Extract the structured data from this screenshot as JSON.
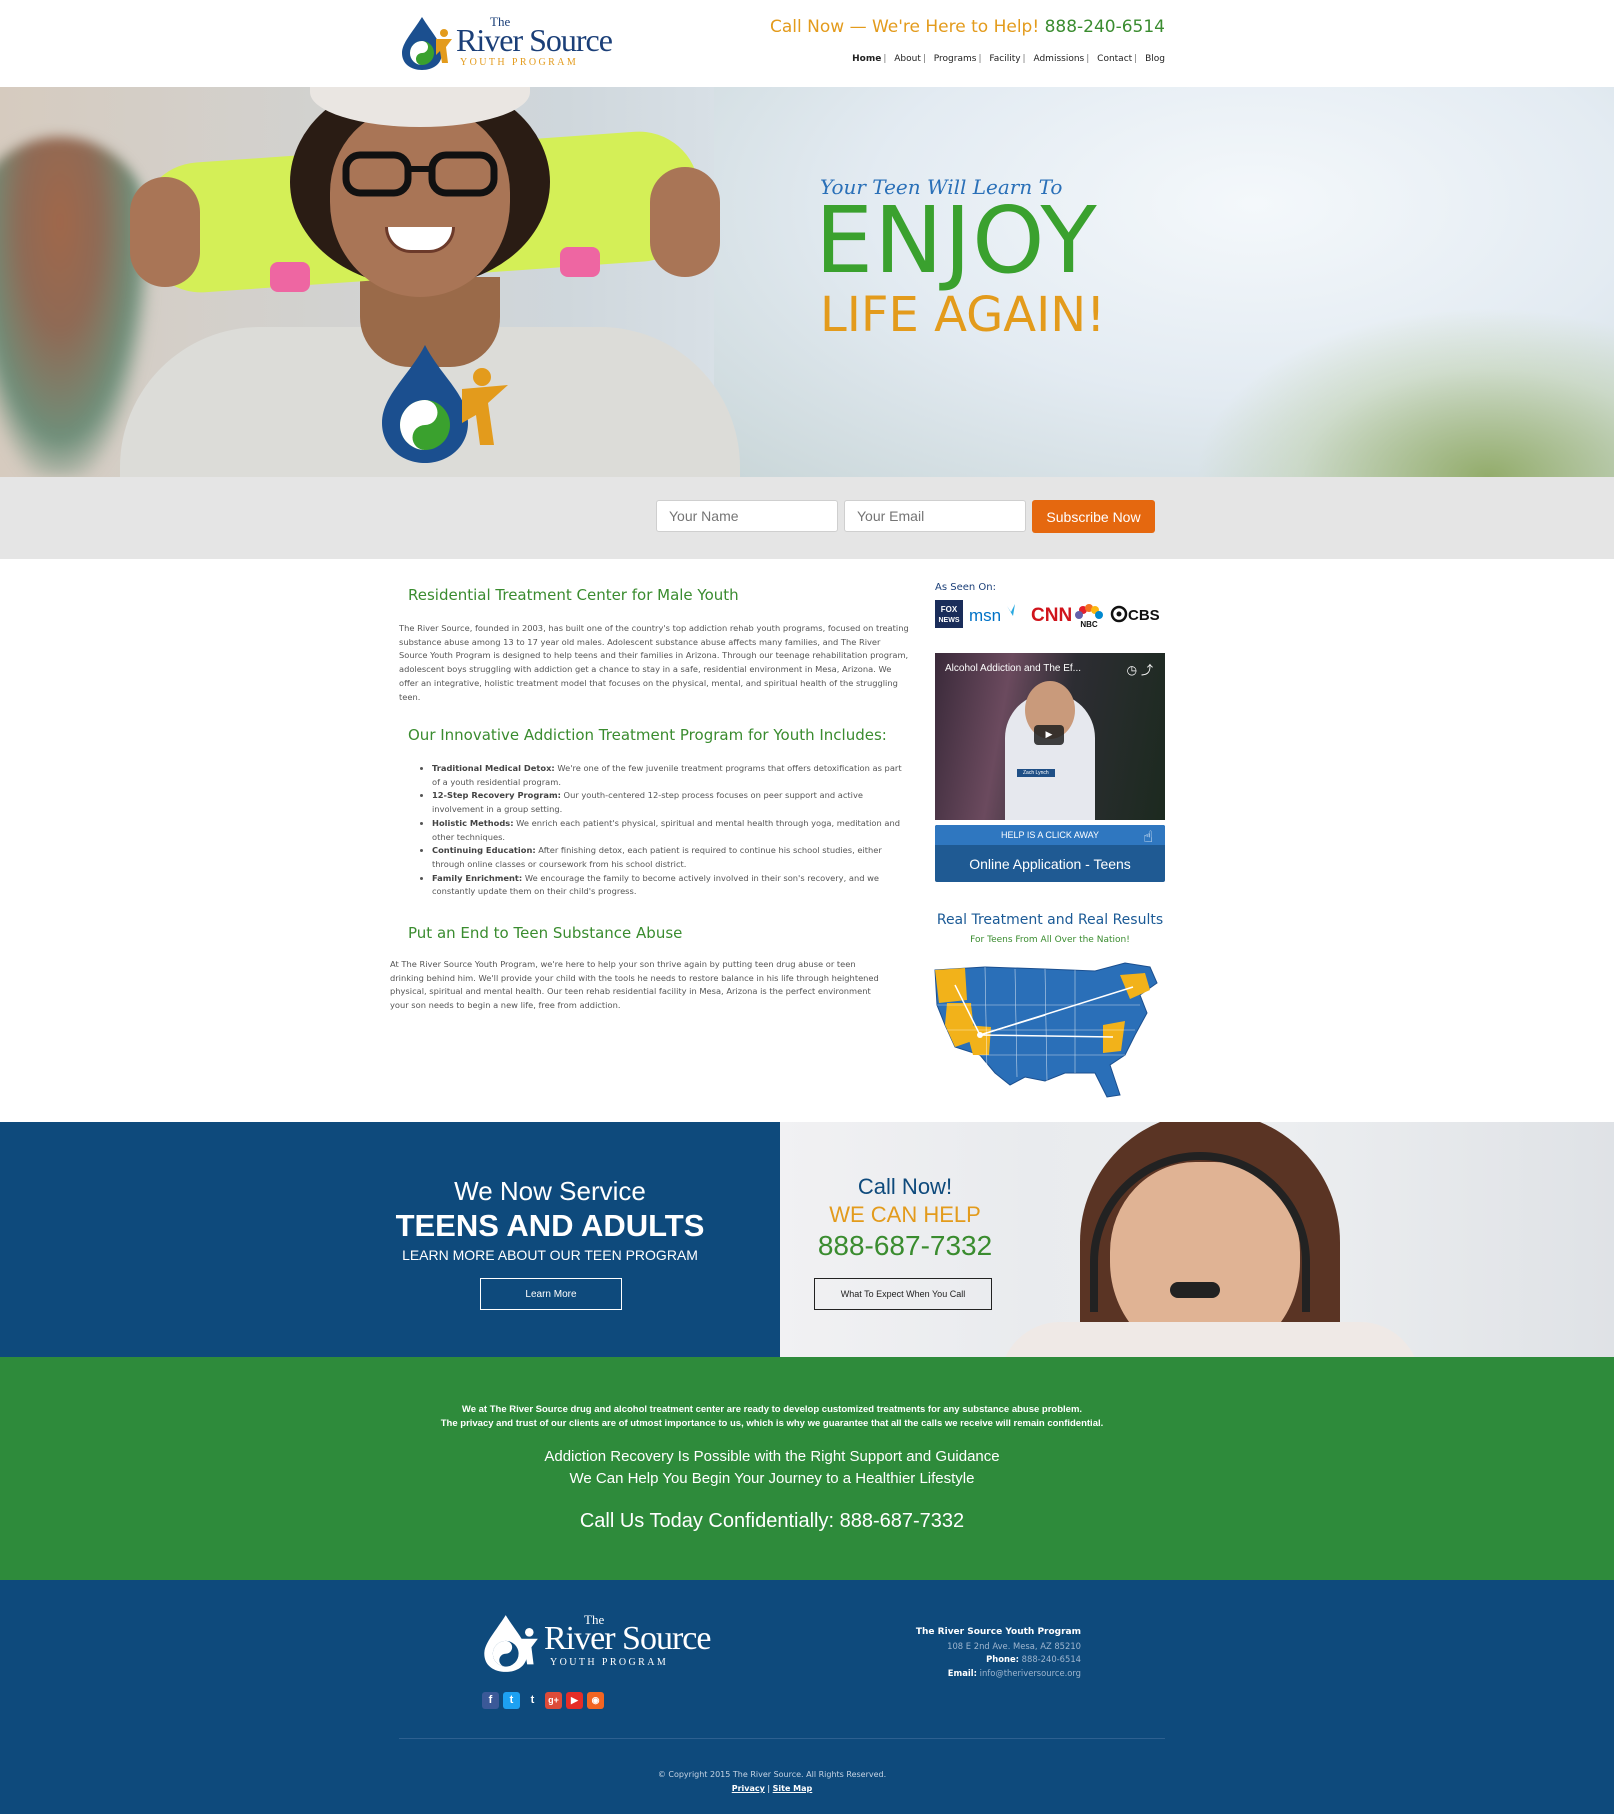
{
  "header": {
    "logo": {
      "the": "The",
      "name": "River Source",
      "sub": "YOUTH PROGRAM"
    },
    "callnow_text": "Call Now — We're Here to Help!",
    "callnow_phone": "888-240-6514",
    "nav": [
      {
        "label": "Home"
      },
      {
        "label": "About"
      },
      {
        "label": "Programs"
      },
      {
        "label": "Facility"
      },
      {
        "label": "Admissions"
      },
      {
        "label": "Contact"
      },
      {
        "label": "Blog"
      }
    ],
    "nav_separator": "|"
  },
  "hero": {
    "subtitle": "Your Teen Will Learn To",
    "headline": "ENJOY",
    "headline2": "LIFE AGAIN!"
  },
  "subscribe": {
    "name_placeholder": "Your Name",
    "email_placeholder": "Your Email",
    "button": "Subscribe Now",
    "button_color": "#e5680f"
  },
  "content": {
    "h1": "Residential Treatment Center for Male Youth",
    "p1": "The River Source, founded in 2003, has built one of the country's top addiction rehab youth programs, focused on treating substance abuse among 13 to 17 year old males. Adolescent substance abuse affects many families, and The River Source Youth Program is designed to help teens and their families in Arizona. Through our teenage rehabilitation program, adolescent boys struggling with addiction get a chance to stay in a safe, residential environment in Mesa, Arizona. We offer an integrative, holistic treatment model that focuses on the physical, mental, and spiritual health of the struggling teen.",
    "h2": "Our Innovative Addiction Treatment Program for Youth Includes:",
    "list": [
      {
        "term": "Traditional Medical Detox:",
        "text": " We're one of the few juvenile treatment programs that offers detoxification as part of a youth residential program."
      },
      {
        "term": "12-Step Recovery Program:",
        "text": " Our youth-centered 12-step process focuses on peer support and active involvement in a group setting."
      },
      {
        "term": "Holistic Methods:",
        "text": " We enrich each patient's physical, spiritual and mental health through yoga, meditation and other techniques."
      },
      {
        "term": "Continuing Education:",
        "text": " After finishing detox, each patient is required to continue his school studies, either through online classes or coursework from his school district."
      },
      {
        "term": "Family Enrichment:",
        "text": " We encourage the family to become actively involved in their son's recovery, and we constantly update them on their child's progress."
      }
    ],
    "h3": "Put an End to Teen Substance Abuse",
    "p3": "At The River Source Youth Program, we're here to help your son thrive again by putting teen drug abuse or teen drinking behind him. We'll provide your child with the tools he needs to restore balance in his life through heightened physical, spiritual and mental health. Our teen rehab residential facility in Mesa, Arizona is the perfect environment your son needs to begin a new life, free from addiction."
  },
  "sidebar": {
    "as_seen_on": "As Seen On:",
    "media": [
      {
        "label": "FOX NEWS"
      },
      {
        "label": "msn"
      },
      {
        "label": "CNN"
      },
      {
        "label": "NBC"
      },
      {
        "label": "CBS"
      }
    ],
    "video_title": "Alcohol Addiction and The Ef...",
    "video_caption": "Zach Lynch",
    "app_top": "HELP IS A CLICK AWAY",
    "app_main": "Online Application - Teens",
    "real_title": "Real Treatment and Real Results",
    "real_sub": "For Teens From All Over the Nation!"
  },
  "services": {
    "now": "We Now Service",
    "teens": "TEENS AND ADULTS",
    "learn": "LEARN MORE ABOUT OUR TEEN PROGRAM",
    "learn_btn": "Learn More",
    "call_now": "Call Now!",
    "we_help": "WE CAN HELP",
    "phone": "888-687-7332",
    "expect_btn": "What To Expect When You Call"
  },
  "green": {
    "small1": "We at The River Source drug and alcohol treatment center are ready to develop customized treatments for any substance abuse problem.",
    "small2": "The privacy and trust of our clients are of utmost importance to us, which is why we guarantee that all the calls we receive will remain confidential.",
    "mid1": "Addiction Recovery Is Possible with the Right Support and Guidance",
    "mid2": "We Can Help You Begin Your Journey to a Healthier Lifestyle",
    "big": "Call Us Today Confidentially: 888-687-7332"
  },
  "footer": {
    "org": "The River Source Youth Program",
    "address": "108 E 2nd Ave. Mesa, AZ 85210",
    "phone_label": "Phone:",
    "phone": "888-240-6514",
    "email_label": "Email:",
    "email": "info@theriversource.org",
    "social": [
      {
        "icon": "facebook-icon",
        "glyph": "f",
        "color": "#3b5998"
      },
      {
        "icon": "twitter-icon",
        "glyph": "t",
        "color": "#1da1f2"
      },
      {
        "icon": "tumblr-icon",
        "glyph": "t",
        "color": "#0e4a7c"
      },
      {
        "icon": "google-plus-icon",
        "glyph": "g+",
        "color": "#dd4b39"
      },
      {
        "icon": "youtube-icon",
        "glyph": "▶",
        "color": "#e52d27"
      },
      {
        "icon": "rss-icon",
        "glyph": "◉",
        "color": "#f26522"
      }
    ],
    "copyright": "© Copyright 2015 The River Source. All Rights Reserved.",
    "privacy": "Privacy",
    "sitemap": "Site Map"
  },
  "colors": {
    "brand_blue": "#0e4a7c",
    "brand_green": "#3a8c2f",
    "brand_orange": "#e39b1c",
    "green_band": "#2e8b3b"
  }
}
